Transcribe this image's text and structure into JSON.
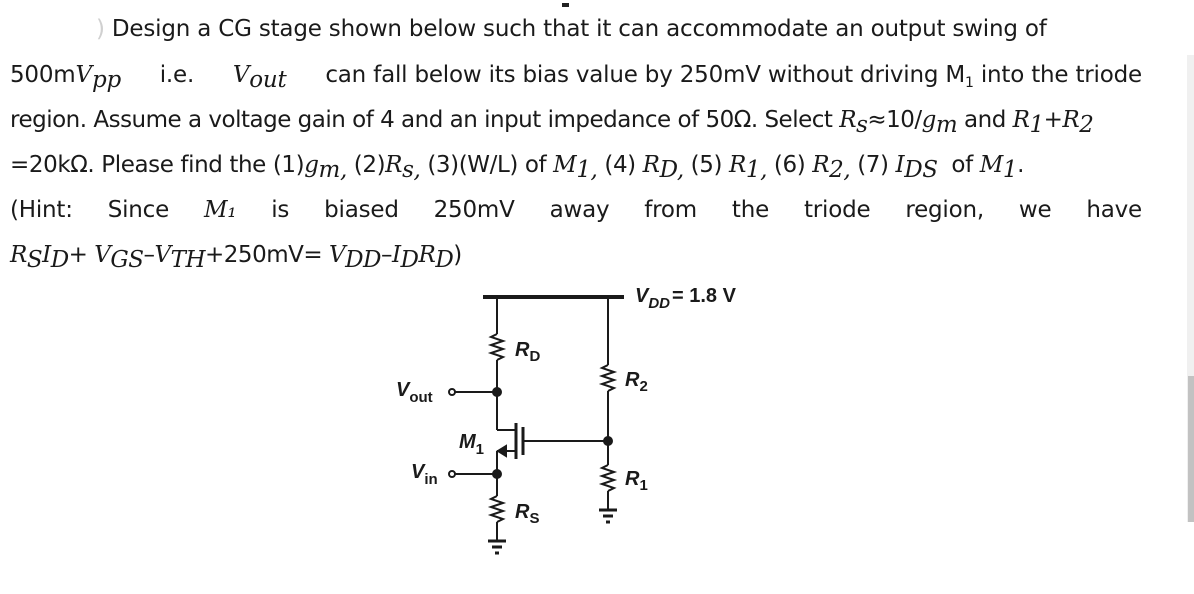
{
  "problem": {
    "marker": ")",
    "line1": "Design a CG stage shown below such that it can accommodate an output swing of",
    "line2": {
      "a": "500m",
      "vpp_base": "V",
      "vpp_sub": "pp",
      "b": " i.e. ",
      "vout_base": "V",
      "vout_sub": "out",
      "c": " can fall below its bias value by 250mV without driving M",
      "m_sub": "1",
      "d": " into the triode"
    },
    "line3": {
      "a": "region. Assume a voltage gain of 4 and an input impedance of 50Ω. Select ",
      "rs": "R",
      "rs_sub": "s",
      "b": "≈10/",
      "gm": "g",
      "gm_sub": "m",
      "c": " and ",
      "r1": "R",
      "r1_sub": "1",
      "plus": "+",
      "r2": "R",
      "r2_sub": "2"
    },
    "line4": {
      "a": "=20kΩ. Please find the (1)",
      "gm": "g",
      "gm_sub": "m,",
      "b": " (2)",
      "rs": "R",
      "rs_sub": "s,",
      "c": " (3)(W/L) of ",
      "m1": "M",
      "m1_sub": "1,",
      "d": " (4) ",
      "rd": "R",
      "rd_sub": "D,",
      "e": " (5) ",
      "r1": "R",
      "r1_sub": "1,",
      "f": " (6) ",
      "r2": "R",
      "r2_sub": "2,",
      "g": " (7) ",
      "ids": "I",
      "ids_sub": "DS",
      "h": "  of ",
      "m1b": "M",
      "m1b_sub": "1",
      "i": "."
    },
    "hint_words": [
      "(Hint:",
      "Since",
      "M₁",
      "is",
      "biased",
      "250mV",
      "away",
      "from",
      "the",
      "triode",
      "region,",
      "we",
      "have"
    ],
    "line6": {
      "rs": "R",
      "rs_sub": "S",
      "id": "I",
      "id_sub": "D",
      "a": "+ ",
      "vgs": "V",
      "vgs_sub": "GS",
      "b": "–",
      "vth": "V",
      "vth_sub": "TH",
      "c": "+250mV= ",
      "vdd": "V",
      "vdd_sub": "DD",
      "d": "–",
      "id2": "I",
      "id2_sub": "D",
      "rd": "R",
      "rd_sub": "D",
      "e": ")"
    }
  },
  "circuit": {
    "vdd_label": "V",
    "vdd_sub": "DD",
    "vdd_value": "= 1.8 V",
    "rd_label": "R",
    "rd_sub": "D",
    "r2_label": "R",
    "r2_sub": "2",
    "r1_label": "R",
    "r1_sub": "1",
    "rs_label": "R",
    "rs_sub": "S",
    "m1_label": "M",
    "m1_sub": "1",
    "vout_label": "V",
    "vout_sub": "out",
    "vin_label": "V",
    "vin_sub": "in"
  }
}
